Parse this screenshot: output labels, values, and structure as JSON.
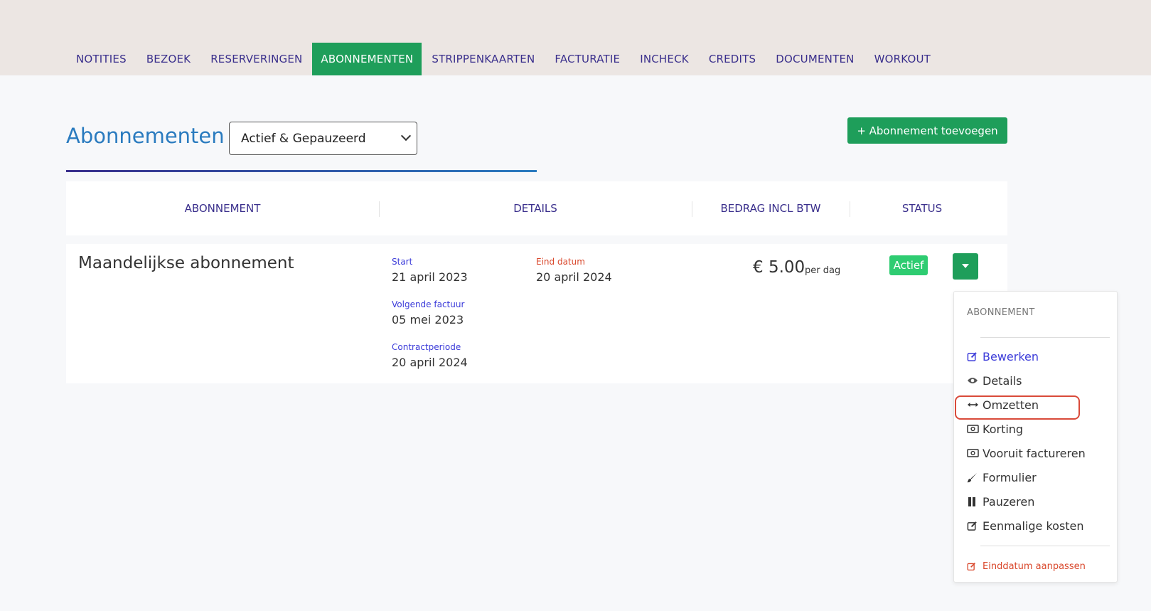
{
  "tabs": [
    {
      "label": "NOTITIES"
    },
    {
      "label": "BEZOEK"
    },
    {
      "label": "RESERVERINGEN"
    },
    {
      "label": "ABONNEMENTEN"
    },
    {
      "label": "STRIPPENKAARTEN"
    },
    {
      "label": "FACTURATIE"
    },
    {
      "label": "INCHECK"
    },
    {
      "label": "CREDITS"
    },
    {
      "label": "DOCUMENTEN"
    },
    {
      "label": "WORKOUT"
    }
  ],
  "active_tab": "ABONNEMENTEN",
  "page": {
    "title": "Abonnementen",
    "filter_value": "Actief & Gepauzeerd",
    "add_button": "+ Abonnement toevoegen"
  },
  "table": {
    "headers": [
      "ABONNEMENT",
      "DETAILS",
      "BEDRAG INCL BTW",
      "STATUS"
    ],
    "row": {
      "name": "Maandelijkse abonnement",
      "start_label": "Start",
      "start_value": "21 april 2023",
      "end_label": "Eind datum",
      "end_value": "20 april 2024",
      "next_invoice_label": "Volgende factuur",
      "next_invoice_value": "05 mei 2023",
      "contract_label": "Contractperiode",
      "contract_value": "20 april 2024",
      "amount": "€ 5.00",
      "amount_unit": "per dag",
      "status": "Actief"
    }
  },
  "menu": {
    "header": "ABONNEMENT",
    "items": [
      {
        "label": "Bewerken",
        "icon": "edit-icon"
      },
      {
        "label": "Details",
        "icon": "eye-icon"
      },
      {
        "label": "Omzetten",
        "icon": "arrows-horizontal-icon"
      },
      {
        "label": "Korting",
        "icon": "money-icon"
      },
      {
        "label": "Vooruit factureren",
        "icon": "money-icon"
      },
      {
        "label": "Formulier",
        "icon": "brush-icon"
      },
      {
        "label": "Pauzeren",
        "icon": "pause-icon"
      },
      {
        "label": "Eenmalige kosten",
        "icon": "edit-icon"
      }
    ],
    "footer_item": {
      "label": "Einddatum aanpassen",
      "icon": "edit-icon"
    }
  },
  "colors": {
    "primary_green": "#1e9e5a",
    "status_green": "#2ecc71",
    "nav_purple": "#3a2f8c",
    "title_blue": "#2a7bbf",
    "danger_red": "#d9472b",
    "highlight_red": "#d94a3a"
  }
}
